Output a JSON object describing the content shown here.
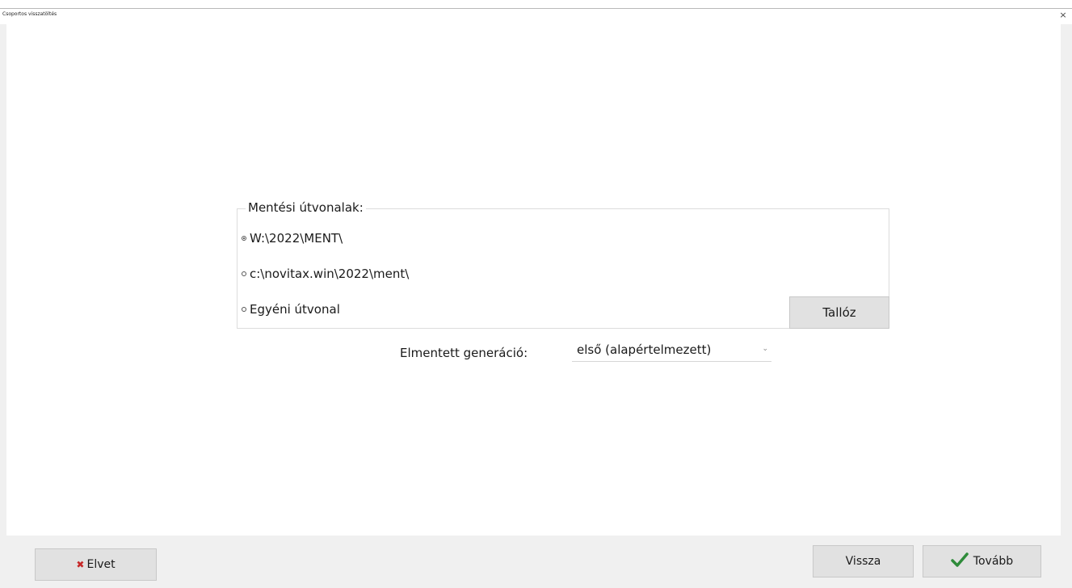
{
  "window": {
    "title": "Csoportos visszatöltés",
    "close_glyph": "×"
  },
  "paths_group": {
    "legend": "Mentési útvonalak:",
    "options": [
      {
        "label": "W:\\2022\\MENT\\",
        "checked": true
      },
      {
        "label": "c:\\novitax.win\\2022\\ment\\",
        "checked": false
      },
      {
        "label": "Egyéni útvonal",
        "checked": false
      }
    ],
    "browse_label": "Tallóz"
  },
  "generation": {
    "label": "Elmentett generáció:",
    "selected": "első (alapértelmezett)",
    "chevron": "⌄"
  },
  "footer": {
    "discard_icon": "✖",
    "discard_label": "Elvet",
    "back_label": "Vissza",
    "next_label": "Tovább",
    "next_icon_color": "#2e8b3a",
    "discard_icon_color": "#c62828"
  }
}
